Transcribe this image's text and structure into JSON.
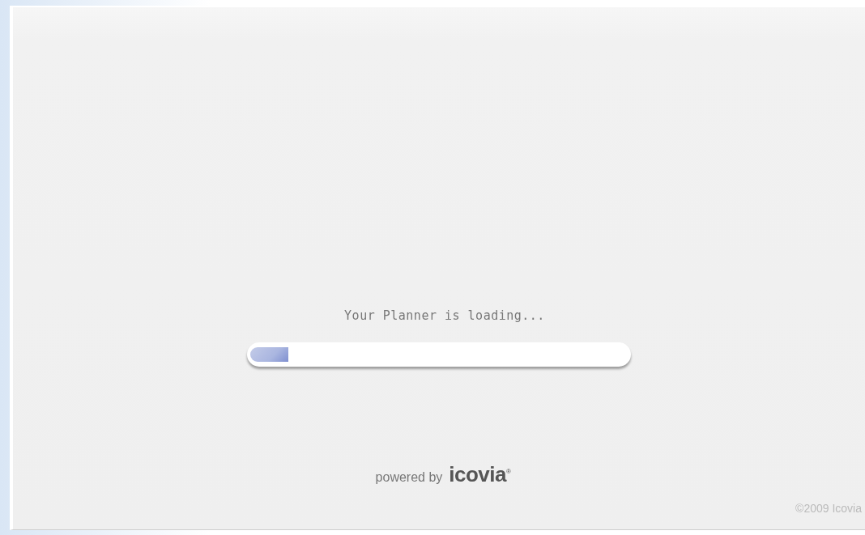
{
  "loader": {
    "message": "Your Planner is loading...",
    "progress": {
      "level": 0.1
    }
  },
  "powered_by": {
    "label": "powered by",
    "brand": "icovia",
    "mark": "®"
  },
  "footer": {
    "copyright": "©2009 Icovia"
  }
}
